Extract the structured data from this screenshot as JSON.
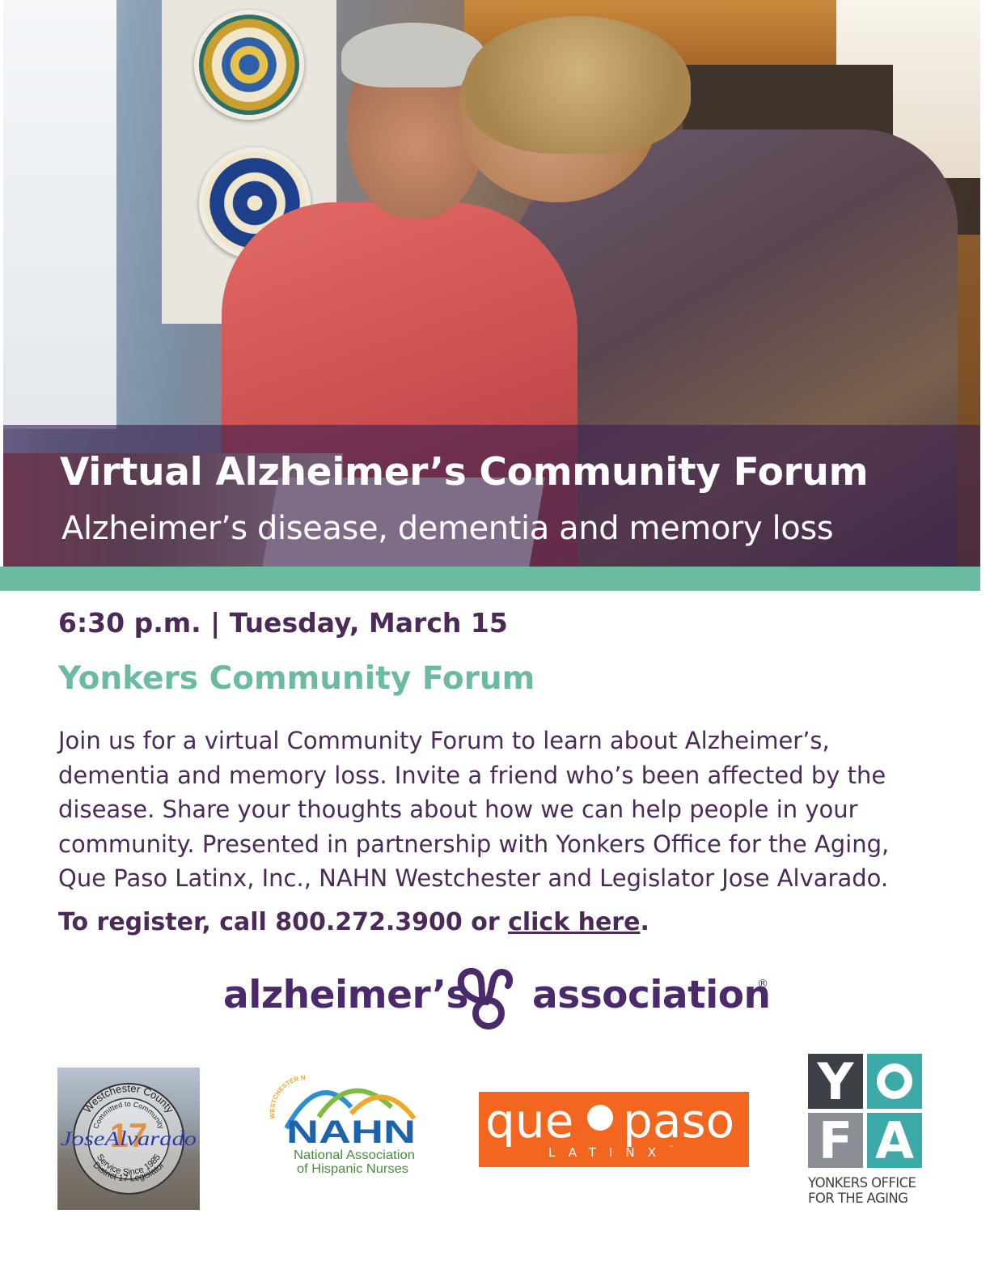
{
  "hero": {
    "title": "Virtual Alzheimer’s Community Forum",
    "subtitle": "Alzheimer’s disease, dementia and memory loss"
  },
  "event": {
    "datetime": "6:30 p.m. | Tuesday, March 15",
    "forum_name": "Yonkers Community Forum",
    "description": "Join us for a virtual Community Forum to learn about Alzheimer’s, dementia and memory loss. Invite a friend who’s been affected by the disease. Share your thoughts about how we can help people in your community. Presented in partnership with Yonkers Office for the Aging, Que Paso Latinx, Inc., NAHN Westchester and Legislator Jose Alvarado.",
    "register_prefix": "To register, call 800.272.3900 or ",
    "register_link": "click here",
    "register_suffix": "."
  },
  "sponsor": {
    "name_left": "alzheimer’s",
    "name_right": "association",
    "registered_mark": "®"
  },
  "partners": {
    "jose": {
      "ring_top": "Westchester County",
      "ring_inner": "Committed to Community",
      "name": "JoseAlvarado",
      "number": "17",
      "ring_bottom": "Service Since 1985",
      "ring_bottom2": "District 17 Legislator"
    },
    "nahn": {
      "chapter": "WESTCHESTER NAHN CHAPTER",
      "acronym": "NAHN",
      "full_name_line1": "National Association",
      "full_name_line2": "of Hispanic Nurses"
    },
    "quepaso": {
      "word1": "que",
      "word2": "paso",
      "sub": "LATINX",
      "trademark": "™"
    },
    "yofa": {
      "letters": [
        "Y",
        "O",
        "F",
        "A"
      ],
      "caption_line1": "YONKERS OFFICE",
      "caption_line2": "FOR THE AGING"
    }
  },
  "colors": {
    "purple": "#4b2a58",
    "teal": "#6cbaa1",
    "overlay": "#3c2050",
    "quepaso_orange": "#f3661f",
    "yofa_teal": "#3ea9a9"
  }
}
